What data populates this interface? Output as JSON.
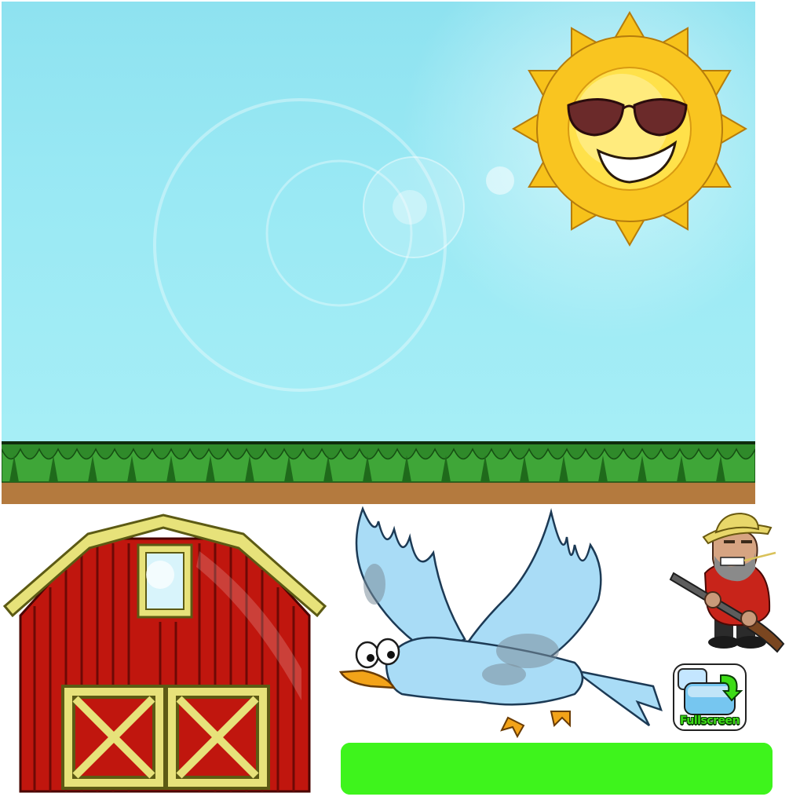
{
  "game": {
    "background": {
      "sky_top_color": "#8ee2f0",
      "sky_bottom_color": "#a6eef6",
      "grass_color": "#2f8a2a",
      "dirt_color": "#b47a3e"
    },
    "sprites": {
      "sun": {
        "icon": "sun-with-sunglasses"
      },
      "barn": {
        "icon": "red-barn",
        "color": "#c0160e",
        "trim_color": "#e7e27a"
      },
      "bird": {
        "icon": "blue-bird",
        "color": "#a9dcf6"
      },
      "farmer": {
        "icon": "farmer-with-shotgun"
      }
    },
    "fullscreen_button": {
      "label": "Fullscreen",
      "icon": "fullscreen-arrow-icon"
    },
    "progress": {
      "value": 1.0,
      "color": "#3ef41c"
    }
  }
}
